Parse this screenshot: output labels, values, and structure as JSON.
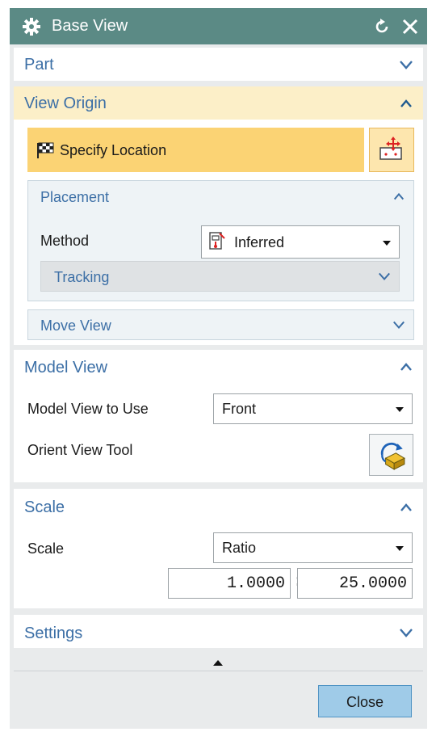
{
  "dialog": {
    "title": "Base View",
    "icons": {
      "gear": "gear-icon",
      "reset": "reset-icon",
      "close": "close-icon"
    }
  },
  "part": {
    "title": "Part"
  },
  "view_origin": {
    "title": "View Origin",
    "specify_location": "Specify Location",
    "placement": {
      "title": "Placement",
      "method_label": "Method",
      "method_value": "Inferred",
      "tracking": "Tracking"
    },
    "move_view": "Move View"
  },
  "model_view": {
    "title": "Model View",
    "model_view_label": "Model View to Use",
    "model_view_value": "Front",
    "orient_label": "Orient View Tool"
  },
  "scale": {
    "title": "Scale",
    "scale_label": "Scale",
    "scale_value": "Ratio",
    "numerator": "1.0000",
    "separator": ":",
    "denominator": "25.0000"
  },
  "settings": {
    "title": "Settings"
  },
  "footer": {
    "close_label": "Close"
  },
  "colors": {
    "titlebar": "#5b8a85",
    "section_header_text": "#3c6fa6",
    "active_header": "#fcefc8",
    "specify_highlight": "#fbd374",
    "close_button": "#9fcbe8"
  }
}
